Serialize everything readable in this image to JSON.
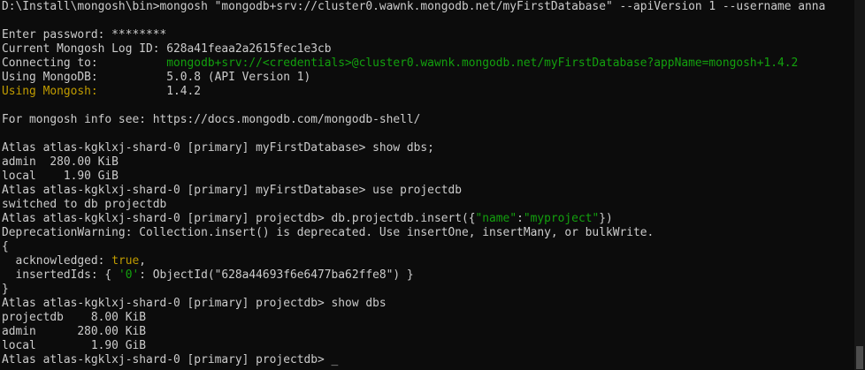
{
  "terminal": {
    "cmd_prefix": "D:\\Install\\mongosh\\bin>mongosh \"mongodb+srv://cluster0.wawnk.mongodb.net/myFirstDatabase\" --apiVersion 1 --username anna",
    "password_line": "Enter password: ********",
    "log_id_line": "Current Mongosh Log ID: 628a41feaa2a2615fec1e3cb",
    "connecting_label": "Connecting to:          ",
    "connecting_value": "mongodb+srv://<credentials>@cluster0.wawnk.mongodb.net/myFirstDatabase?appName=mongosh+1.4.2",
    "using_mongodb_label": "Using MongoDB:          ",
    "using_mongodb_value": "5.0.8 (API Version 1)",
    "using_mongosh_label": "Using Mongosh:",
    "using_mongosh_pad": "          ",
    "using_mongosh_value": "1.4.2",
    "info_line": "For mongosh info see: https://docs.mongodb.com/mongodb-shell/",
    "prompt_first": "Atlas atlas-kgklxj-shard-0 [primary] myFirstDatabase> ",
    "cmd_show_dbs_semicolon": "show dbs;",
    "dbs1_admin": "admin  280.00 KiB",
    "dbs1_local": "local    1.90 GiB",
    "cmd_use": "use projectdb",
    "switched": "switched to db projectdb",
    "prompt_project": "Atlas atlas-kgklxj-shard-0 [primary] projectdb> ",
    "insert_prefix": "db.projectdb.insert({",
    "insert_key": "\"name\"",
    "insert_colon": ":",
    "insert_value": "\"myproject\"",
    "insert_suffix": "})",
    "deprecation": "DeprecationWarning: Collection.insert() is deprecated. Use insertOne, insertMany, or bulkWrite.",
    "brace_open": "{",
    "ack_label": "  acknowledged: ",
    "ack_value": "true",
    "ack_comma": ",",
    "ids_label": "  insertedIds: { ",
    "ids_key": "'0'",
    "ids_rest": ": ObjectId(\"628a44693f6e6477ba62ffe8\") }",
    "brace_close": "}",
    "cmd_show_dbs": "show dbs",
    "dbs2_projectdb": "projectdb    8.00 KiB",
    "dbs2_admin": "admin      280.00 KiB",
    "dbs2_local": "local        1.90 GiB",
    "cursor": "_"
  },
  "colors": {
    "background": "#0c0c0c",
    "foreground": "#cccccc",
    "green": "#13a10e",
    "yellow": "#c19c00"
  }
}
